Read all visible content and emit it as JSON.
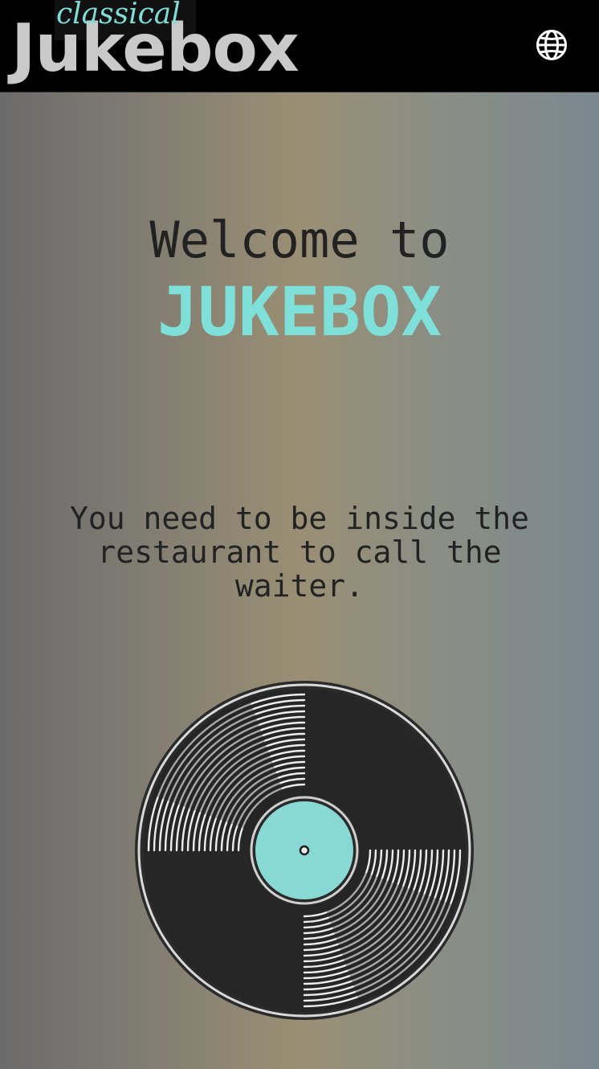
{
  "header": {
    "logo_script": "classical",
    "logo_main": "Jukebox",
    "language_icon": "globe-icon"
  },
  "main": {
    "welcome": "Welcome to",
    "brand": "JUKEBOX",
    "message": "You need to be inside the restaurant to call the waiter."
  },
  "illustration": {
    "icon": "vinyl-record-icon",
    "label_color": "#88d8d4"
  },
  "colors": {
    "accent": "#7fe0da",
    "header_bg": "#000000",
    "text": "#222222"
  }
}
